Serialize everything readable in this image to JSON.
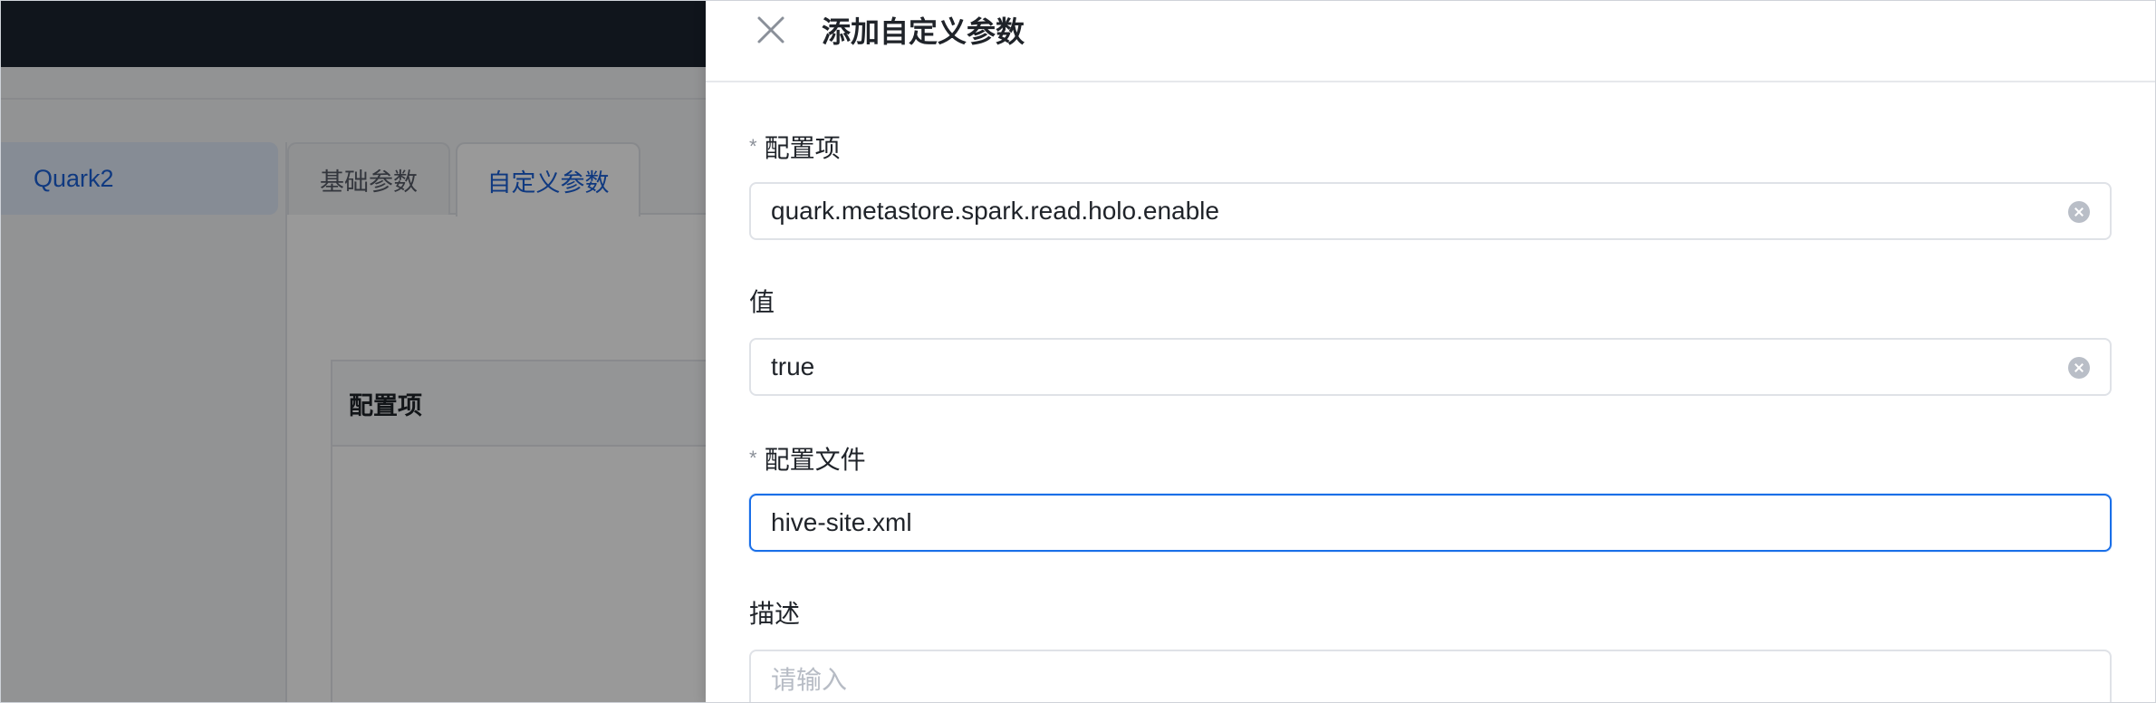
{
  "sidebar": {
    "active_item": "Quark2"
  },
  "tabs": [
    {
      "label": "基础参数"
    },
    {
      "label": "自定义参数"
    }
  ],
  "table": {
    "header_config_item": "配置项"
  },
  "drawer": {
    "title": "添加自定义参数",
    "fields": {
      "config_item": {
        "label": "配置项",
        "required_mark": "*",
        "value": "quark.metastore.spark.read.holo.enable"
      },
      "value": {
        "label": "值",
        "value": "true"
      },
      "config_file": {
        "label": "配置文件",
        "required_mark": "*",
        "value": "hive-site.xml"
      },
      "description": {
        "label": "描述",
        "placeholder": "请输入"
      }
    }
  },
  "colors": {
    "accent": "#1a6fe8",
    "topbar": "#1c2330"
  },
  "icons": {
    "close": "close-icon",
    "clear": "clear-circle-icon"
  }
}
